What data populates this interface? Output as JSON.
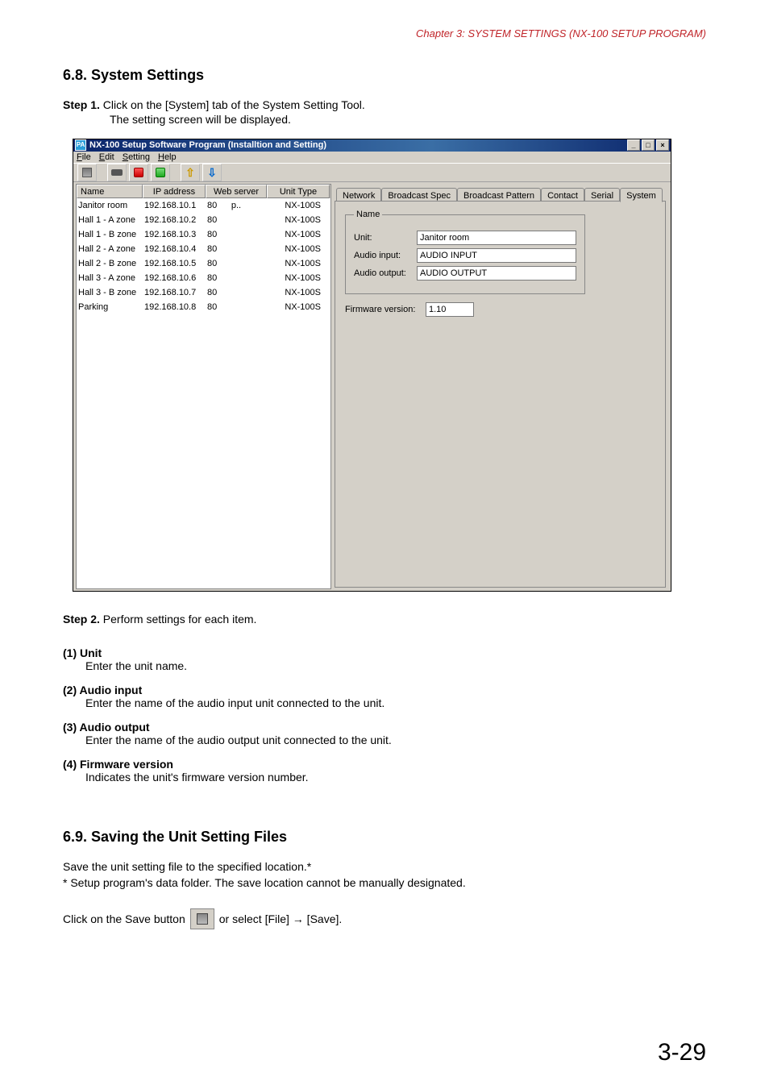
{
  "chapter": "Chapter 3:  SYSTEM SETTINGS (NX-100 SETUP PROGRAM)",
  "section68": "6.8. System Settings",
  "step1": {
    "label": "Step 1.",
    "text": " Click on the [System] tab of the System Setting Tool.",
    "cont": "The setting screen will be displayed."
  },
  "app": {
    "icon": "PA",
    "title": "NX-100 Setup Software Program (Installtion and Setting)",
    "menu": {
      "file": "File",
      "edit": "Edit",
      "setting": "Setting",
      "help": "Help"
    },
    "table": {
      "headers": {
        "name": "Name",
        "ip": "IP address",
        "port": "Web server p..",
        "type": "Unit Type"
      },
      "rows": [
        {
          "name": "Janitor room",
          "ip": "192.168.10.1",
          "port": "80",
          "type": "NX-100S"
        },
        {
          "name": "Hall 1 - A zone",
          "ip": "192.168.10.2",
          "port": "80",
          "type": "NX-100S"
        },
        {
          "name": "Hall 1 - B zone",
          "ip": "192.168.10.3",
          "port": "80",
          "type": "NX-100S"
        },
        {
          "name": "Hall 2 - A zone",
          "ip": "192.168.10.4",
          "port": "80",
          "type": "NX-100S"
        },
        {
          "name": "Hall 2 - B zone",
          "ip": "192.168.10.5",
          "port": "80",
          "type": "NX-100S"
        },
        {
          "name": "Hall 3 - A zone",
          "ip": "192.168.10.6",
          "port": "80",
          "type": "NX-100S"
        },
        {
          "name": "Hall 3 - B zone",
          "ip": "192.168.10.7",
          "port": "80",
          "type": "NX-100S"
        },
        {
          "name": "Parking",
          "ip": "192.168.10.8",
          "port": "80",
          "type": "NX-100S"
        }
      ]
    },
    "tabs": [
      "Network",
      "Broadcast Spec",
      "Broadcast Pattern",
      "Contact",
      "Serial",
      "System"
    ],
    "group_legend": "Name",
    "fields": {
      "unit_label": "Unit:",
      "unit_value": "Janitor room",
      "ain_label": "Audio input:",
      "ain_value": "AUDIO INPUT",
      "aout_label": "Audio output:",
      "aout_value": "AUDIO OUTPUT",
      "fw_label": "Firmware version:",
      "fw_value": "1.10"
    }
  },
  "step2": {
    "label": "Step 2.",
    "text": " Perform settings for each item."
  },
  "items": [
    {
      "title": "(1) Unit",
      "body": "Enter the unit name."
    },
    {
      "title": "(2) Audio input",
      "body": "Enter the name of the audio input unit connected to the unit."
    },
    {
      "title": "(3) Audio output",
      "body": "Enter the name of the audio output unit connected to the unit."
    },
    {
      "title": "(4) Firmware version",
      "body": "Indicates the unit's firmware version number."
    }
  ],
  "section69": "6.9. Saving the Unit Setting Files",
  "save_p1": "Save the unit setting file to the specified location.*",
  "save_p2": "*  Setup program's data folder. The save location cannot be manually designated.",
  "save_line_a": "Click on the Save button",
  "save_line_b": "or select [File] → [Save].",
  "page_number": "3-29"
}
